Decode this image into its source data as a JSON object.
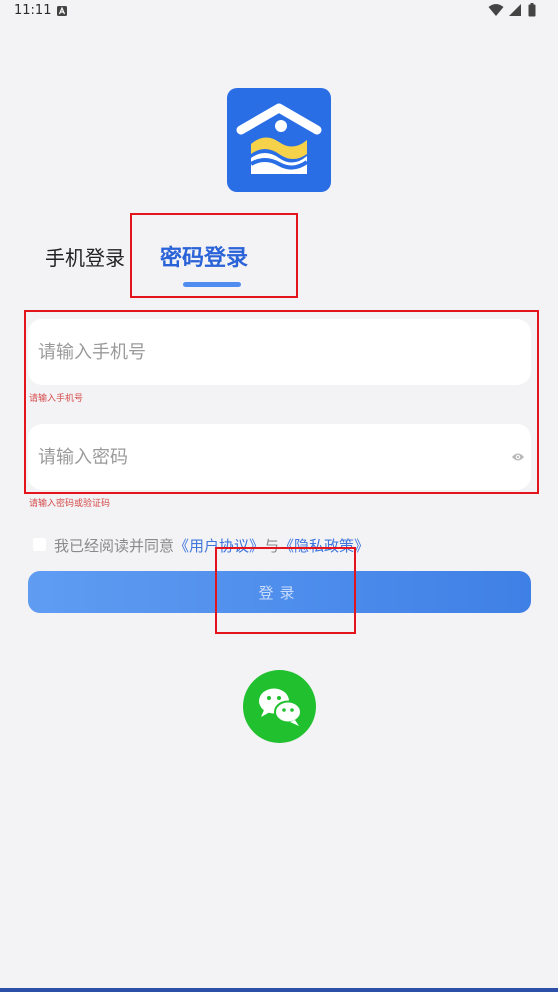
{
  "status_bar": {
    "time": "11:11"
  },
  "tabs": {
    "phone_login": "手机登录",
    "password_login": "密码登录",
    "active": "password_login"
  },
  "form": {
    "phone_placeholder": "请输入手机号",
    "phone_error": "请输入手机号",
    "password_placeholder": "请输入密码",
    "password_error": "请输入密码或验证码"
  },
  "agreement": {
    "checked": false,
    "prefix": "我已经阅读并同意",
    "user_agreement": "《用户协议》",
    "and": "与",
    "privacy_policy": "《隐私政策》"
  },
  "login_button": {
    "label": "登录"
  },
  "icons": {
    "logo": "house-wave-logo-icon",
    "wechat": "wechat-icon",
    "password_toggle": "eye-icon"
  },
  "colors": {
    "brand_blue": "#2a6ee6",
    "active_tab": "#2a62d8",
    "link": "#3f76dc",
    "error": "#d64b4b",
    "wechat_green": "#21c02f",
    "annotation_red": "#e3141c"
  }
}
